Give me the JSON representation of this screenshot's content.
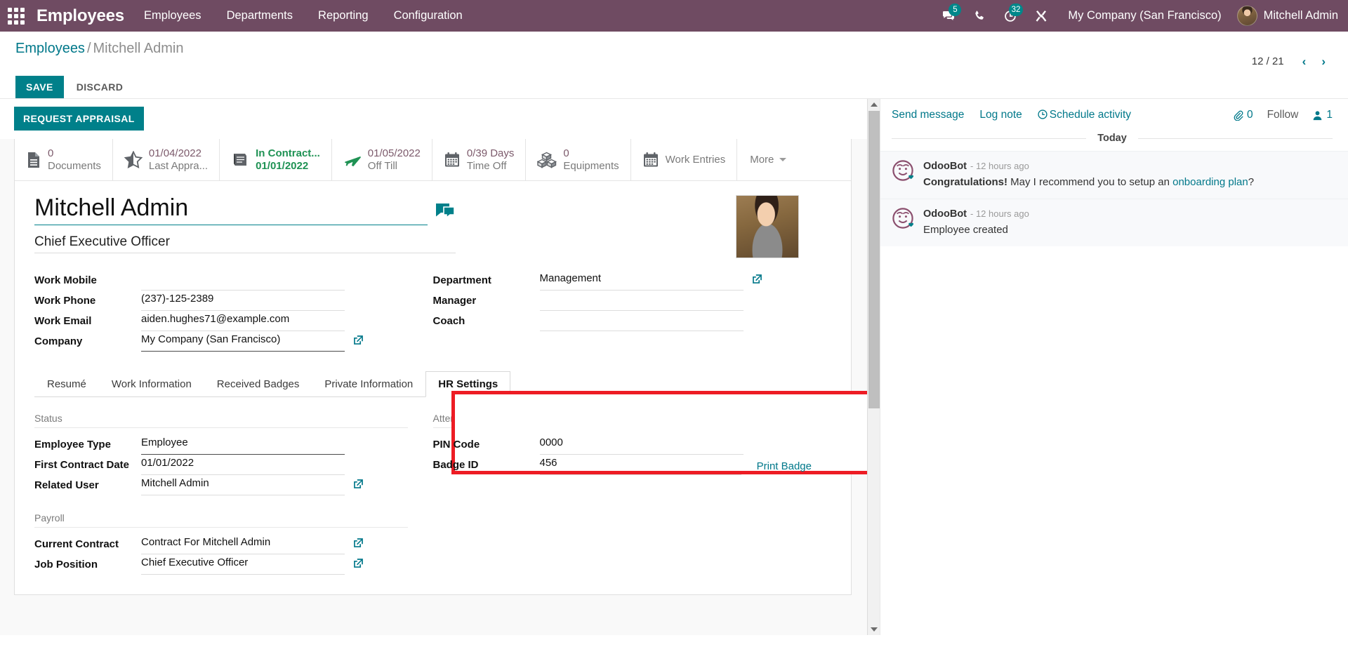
{
  "navbar": {
    "apps_icon": "apps-grid-icon",
    "brand": "Employees",
    "menu": [
      {
        "label": "Employees"
      },
      {
        "label": "Departments"
      },
      {
        "label": "Reporting"
      },
      {
        "label": "Configuration"
      }
    ],
    "icons": [
      {
        "name": "messages-icon",
        "badge": "5"
      },
      {
        "name": "phone-icon",
        "badge": ""
      },
      {
        "name": "activities-clock-icon",
        "badge": "32"
      },
      {
        "name": "debug-tools-icon",
        "badge": ""
      }
    ],
    "company": "My Company (San Francisco)",
    "user": "Mitchell Admin",
    "accent": "#6f4b62",
    "badge_color": "#00878a"
  },
  "control_panel": {
    "breadcrumb_root": "Employees",
    "breadcrumb_sep": "/",
    "breadcrumb_current": "Mitchell Admin",
    "save_label": "SAVE",
    "discard_label": "DISCARD",
    "pager_count": "12 / 21",
    "pager_prev": "‹",
    "pager_next": "›"
  },
  "actions": {
    "request_appraisal": "REQUEST APPRAISAL"
  },
  "stat_buttons": [
    {
      "icon": "document-icon",
      "value": "0",
      "label": "Documents",
      "green": false
    },
    {
      "icon": "star-half-icon",
      "value": "01/04/2022",
      "label": "Last Appra...",
      "green": false
    },
    {
      "icon": "contract-book-icon",
      "value": "In Contract...",
      "label": "01/01/2022",
      "green": true
    },
    {
      "icon": "plane-icon",
      "value": "01/05/2022",
      "label": "Off Till",
      "green": false
    },
    {
      "icon": "calendar-icon",
      "value": "0/39 Days",
      "label": "Time Off",
      "green": false
    },
    {
      "icon": "equipment-boxes-icon",
      "value": "0",
      "label": "Equipments",
      "green": false
    },
    {
      "icon": "calendar-icon",
      "value": "",
      "label": "Work Entries",
      "green": false
    }
  ],
  "stat_more": "More",
  "record": {
    "name": "Mitchell Admin",
    "job_title": "Chief Executive Officer",
    "left_fields": [
      {
        "label": "Work Mobile",
        "value": ""
      },
      {
        "label": "Work Phone",
        "value": "(237)-125-2389"
      },
      {
        "label": "Work Email",
        "value": "aiden.hughes71@example.com"
      },
      {
        "label": "Company",
        "value": "My Company (San Francisco)"
      }
    ],
    "right_fields": [
      {
        "label": "Department",
        "value": "Management"
      },
      {
        "label": "Manager",
        "value": ""
      },
      {
        "label": "Coach",
        "value": ""
      }
    ]
  },
  "notebook": {
    "tabs": [
      {
        "label": "Resumé",
        "active": false
      },
      {
        "label": "Work Information",
        "active": false
      },
      {
        "label": "Received Badges",
        "active": false
      },
      {
        "label": "Private Information",
        "active": false
      },
      {
        "label": "HR Settings",
        "active": true
      }
    ]
  },
  "hr_settings": {
    "status_section": "Status",
    "status_fields": [
      {
        "label": "Employee Type",
        "value": "Employee"
      },
      {
        "label": "First Contract Date",
        "value": "01/01/2022"
      },
      {
        "label": "Related User",
        "value": "Mitchell Admin"
      }
    ],
    "payroll_section": "Payroll",
    "payroll_fields": [
      {
        "label": "Current Contract",
        "value": "Contract For Mitchell Admin"
      },
      {
        "label": "Job Position",
        "value": "Chief Executive Officer"
      }
    ],
    "attendance_section": "Attendance/Point of Sale",
    "attendance_fields": [
      {
        "label": "PIN Code",
        "value": "0000"
      },
      {
        "label": "Badge ID",
        "value": "456"
      }
    ],
    "print_badge": "Print Badge",
    "highlight_color": "#ed1c24"
  },
  "chatter": {
    "send_message": "Send message",
    "log_note": "Log note",
    "schedule_activity": "Schedule activity",
    "attachment_count": "0",
    "follow_label": "Follow",
    "follower_count": "1",
    "day_label": "Today",
    "messages": [
      {
        "author": "OdooBot",
        "time": "- 12 hours ago",
        "text_bold": "Congratulations!",
        "text_mid": " May I recommend you to setup an ",
        "text_link": "onboarding plan",
        "text_end": "?"
      },
      {
        "author": "OdooBot",
        "time": "- 12 hours ago",
        "text_bold": "",
        "text_mid": "Employee created",
        "text_link": "",
        "text_end": ""
      }
    ]
  }
}
